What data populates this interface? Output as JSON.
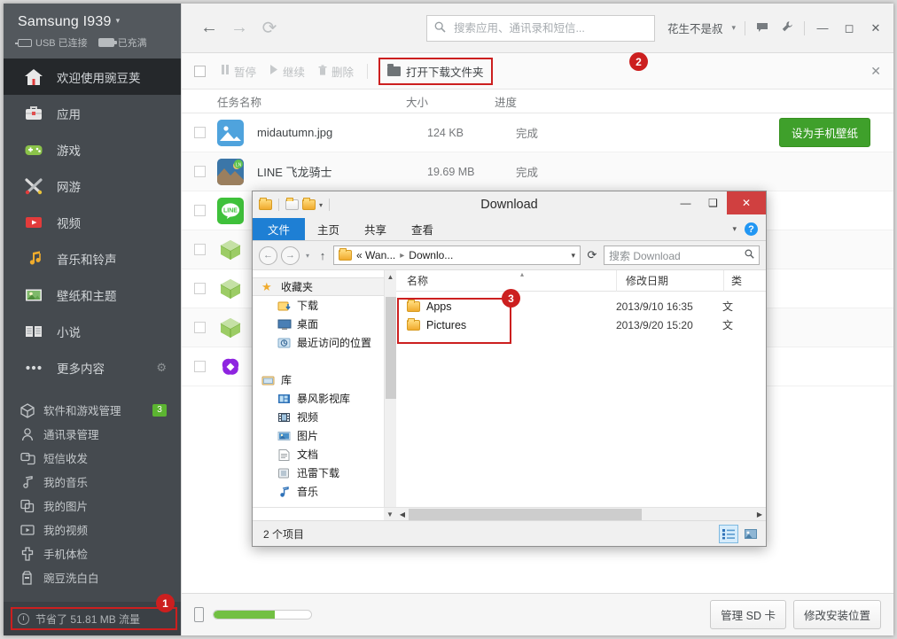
{
  "sidebar": {
    "device": {
      "name": "Samsung I939",
      "caret": "▾",
      "usb_status": "USB 已连接",
      "battery_status": "已充满"
    },
    "primary": [
      {
        "label": "欢迎使用豌豆荚",
        "icon": "home-icon",
        "active": true
      },
      {
        "label": "应用",
        "icon": "briefcase-icon",
        "active": false
      },
      {
        "label": "游戏",
        "icon": "gamepad-icon",
        "active": false
      },
      {
        "label": "网游",
        "icon": "swords-icon",
        "active": false
      },
      {
        "label": "视频",
        "icon": "play-icon",
        "active": false
      },
      {
        "label": "音乐和铃声",
        "icon": "music-note-icon",
        "active": false
      },
      {
        "label": "壁纸和主题",
        "icon": "picture-icon",
        "active": false
      },
      {
        "label": "小说",
        "icon": "book-icon",
        "active": false
      },
      {
        "label": "更多内容",
        "icon": "ellipsis-icon",
        "active": false,
        "gear": "⚙"
      }
    ],
    "secondary": [
      {
        "label": "软件和游戏管理",
        "icon": "cube-icon",
        "badge": "3"
      },
      {
        "label": "通讯录管理",
        "icon": "person-icon",
        "badge": ""
      },
      {
        "label": "短信收发",
        "icon": "chat-icon",
        "badge": ""
      },
      {
        "label": "我的音乐",
        "icon": "music-note-icon",
        "badge": ""
      },
      {
        "label": "我的图片",
        "icon": "images-icon",
        "badge": ""
      },
      {
        "label": "我的视频",
        "icon": "video-icon",
        "badge": ""
      },
      {
        "label": "手机体检",
        "icon": "medical-cross-icon",
        "badge": ""
      },
      {
        "label": "豌豆洗白白",
        "icon": "wash-icon",
        "badge": ""
      }
    ],
    "saved_traffic": "节省了 51.81 MB 流量",
    "saved_step_badge": "1"
  },
  "topbar": {
    "back": "←",
    "forward": "→",
    "refresh": "⟳",
    "search_placeholder": "搜索应用、通讯录和短信...",
    "search_value": "",
    "user_name": "花生不是叔",
    "user_caret": "▾",
    "message_icon": "speech-bubble-icon",
    "tools_icon": "wrench-icon",
    "minimize": "―",
    "maximize": "◻",
    "close": "✕"
  },
  "download_toolbar": {
    "pause": "暂停",
    "resume": "继续",
    "delete": "删除",
    "open_folder": "打开下载文件夹",
    "open_folder_step_badge": "2",
    "close": "✕"
  },
  "columns": {
    "name": "任务名称",
    "size": "大小",
    "progress": "进度"
  },
  "downloads": [
    {
      "name": "midautumn.jpg",
      "size": "124 KB",
      "progress": "完成",
      "icon": "image-file-icon",
      "action": "设为手机壁纸"
    },
    {
      "name": "LINE 飞龙骑士",
      "size": "19.69 MB",
      "progress": "完成",
      "icon": "line-game-icon",
      "action": ""
    },
    {
      "name": "",
      "size": "",
      "progress": "",
      "icon": "line-app-icon",
      "action": ""
    },
    {
      "name": "",
      "size": "",
      "progress": "",
      "icon": "apk-cube-icon",
      "action": ""
    },
    {
      "name": "",
      "size": "",
      "progress": "",
      "icon": "apk-cube-icon",
      "action": ""
    },
    {
      "name": "",
      "size": "",
      "progress": "",
      "icon": "apk-cube-icon",
      "action": ""
    },
    {
      "name": "",
      "size": "",
      "progress": "",
      "icon": "purple-knot-icon",
      "action": ""
    }
  ],
  "statusbar": {
    "phone_icon": "phone-icon",
    "storage_percent": 63,
    "manage_sd": "管理 SD 卡",
    "change_install": "修改安装位置"
  },
  "explorer": {
    "title": "Download",
    "quick_access": {
      "folder": "folder-icon",
      "new_folder": "new-folder-icon",
      "props": "properties-icon",
      "dropdown": "▾"
    },
    "window_controls": {
      "minimize": "―",
      "maximize": "❑",
      "close": "✕"
    },
    "ribbon_tabs": [
      {
        "label": "文件",
        "active": true
      },
      {
        "label": "主页",
        "active": false
      },
      {
        "label": "共享",
        "active": false
      },
      {
        "label": "查看",
        "active": false
      }
    ],
    "ribbon_collapse": "▾",
    "help_icon": "?",
    "address": {
      "back": "←",
      "forward": "→",
      "recent": "▾",
      "up": "↑",
      "crumbs": [
        "« Wan...",
        "Downlo..."
      ],
      "crumb_sep": "▸",
      "dropdown": "▾",
      "refresh": "⟳"
    },
    "search": {
      "placeholder": "搜索 Download",
      "value": "",
      "icon": "magnifier-icon"
    },
    "tree": [
      {
        "label": "收藏夹",
        "icon": "star-icon",
        "level": 0,
        "selected": true
      },
      {
        "label": "下载",
        "icon": "download-folder-icon",
        "level": 1,
        "selected": false
      },
      {
        "label": "桌面",
        "icon": "desktop-icon",
        "level": 1,
        "selected": false
      },
      {
        "label": "最近访问的位置",
        "icon": "recent-places-icon",
        "level": 1,
        "selected": false
      },
      {
        "label": "",
        "icon": "",
        "level": 1,
        "selected": false
      },
      {
        "label": "库",
        "icon": "library-icon",
        "level": 0,
        "selected": false
      },
      {
        "label": "暴风影视库",
        "icon": "baofeng-icon",
        "level": 1,
        "selected": false
      },
      {
        "label": "视频",
        "icon": "video-library-icon",
        "level": 1,
        "selected": false
      },
      {
        "label": "图片",
        "icon": "pictures-library-icon",
        "level": 1,
        "selected": false
      },
      {
        "label": "文档",
        "icon": "documents-library-icon",
        "level": 1,
        "selected": false
      },
      {
        "label": "迅雷下载",
        "icon": "thunder-download-icon",
        "level": 1,
        "selected": false
      },
      {
        "label": "音乐",
        "icon": "music-library-icon",
        "level": 1,
        "selected": false
      }
    ],
    "file_columns": {
      "name": "名称",
      "date": "修改日期",
      "type": "类"
    },
    "files": [
      {
        "name": "Apps",
        "date": "2013/9/10 16:35",
        "type": "文",
        "icon": "folder-icon"
      },
      {
        "name": "Pictures",
        "date": "2013/9/20 15:20",
        "type": "文",
        "icon": "folder-icon"
      }
    ],
    "files_step_badge": "3",
    "status_count": "2 个项目",
    "view_buttons": [
      {
        "name": "details-view",
        "on": true
      },
      {
        "name": "large-icons-view",
        "on": false
      }
    ]
  }
}
